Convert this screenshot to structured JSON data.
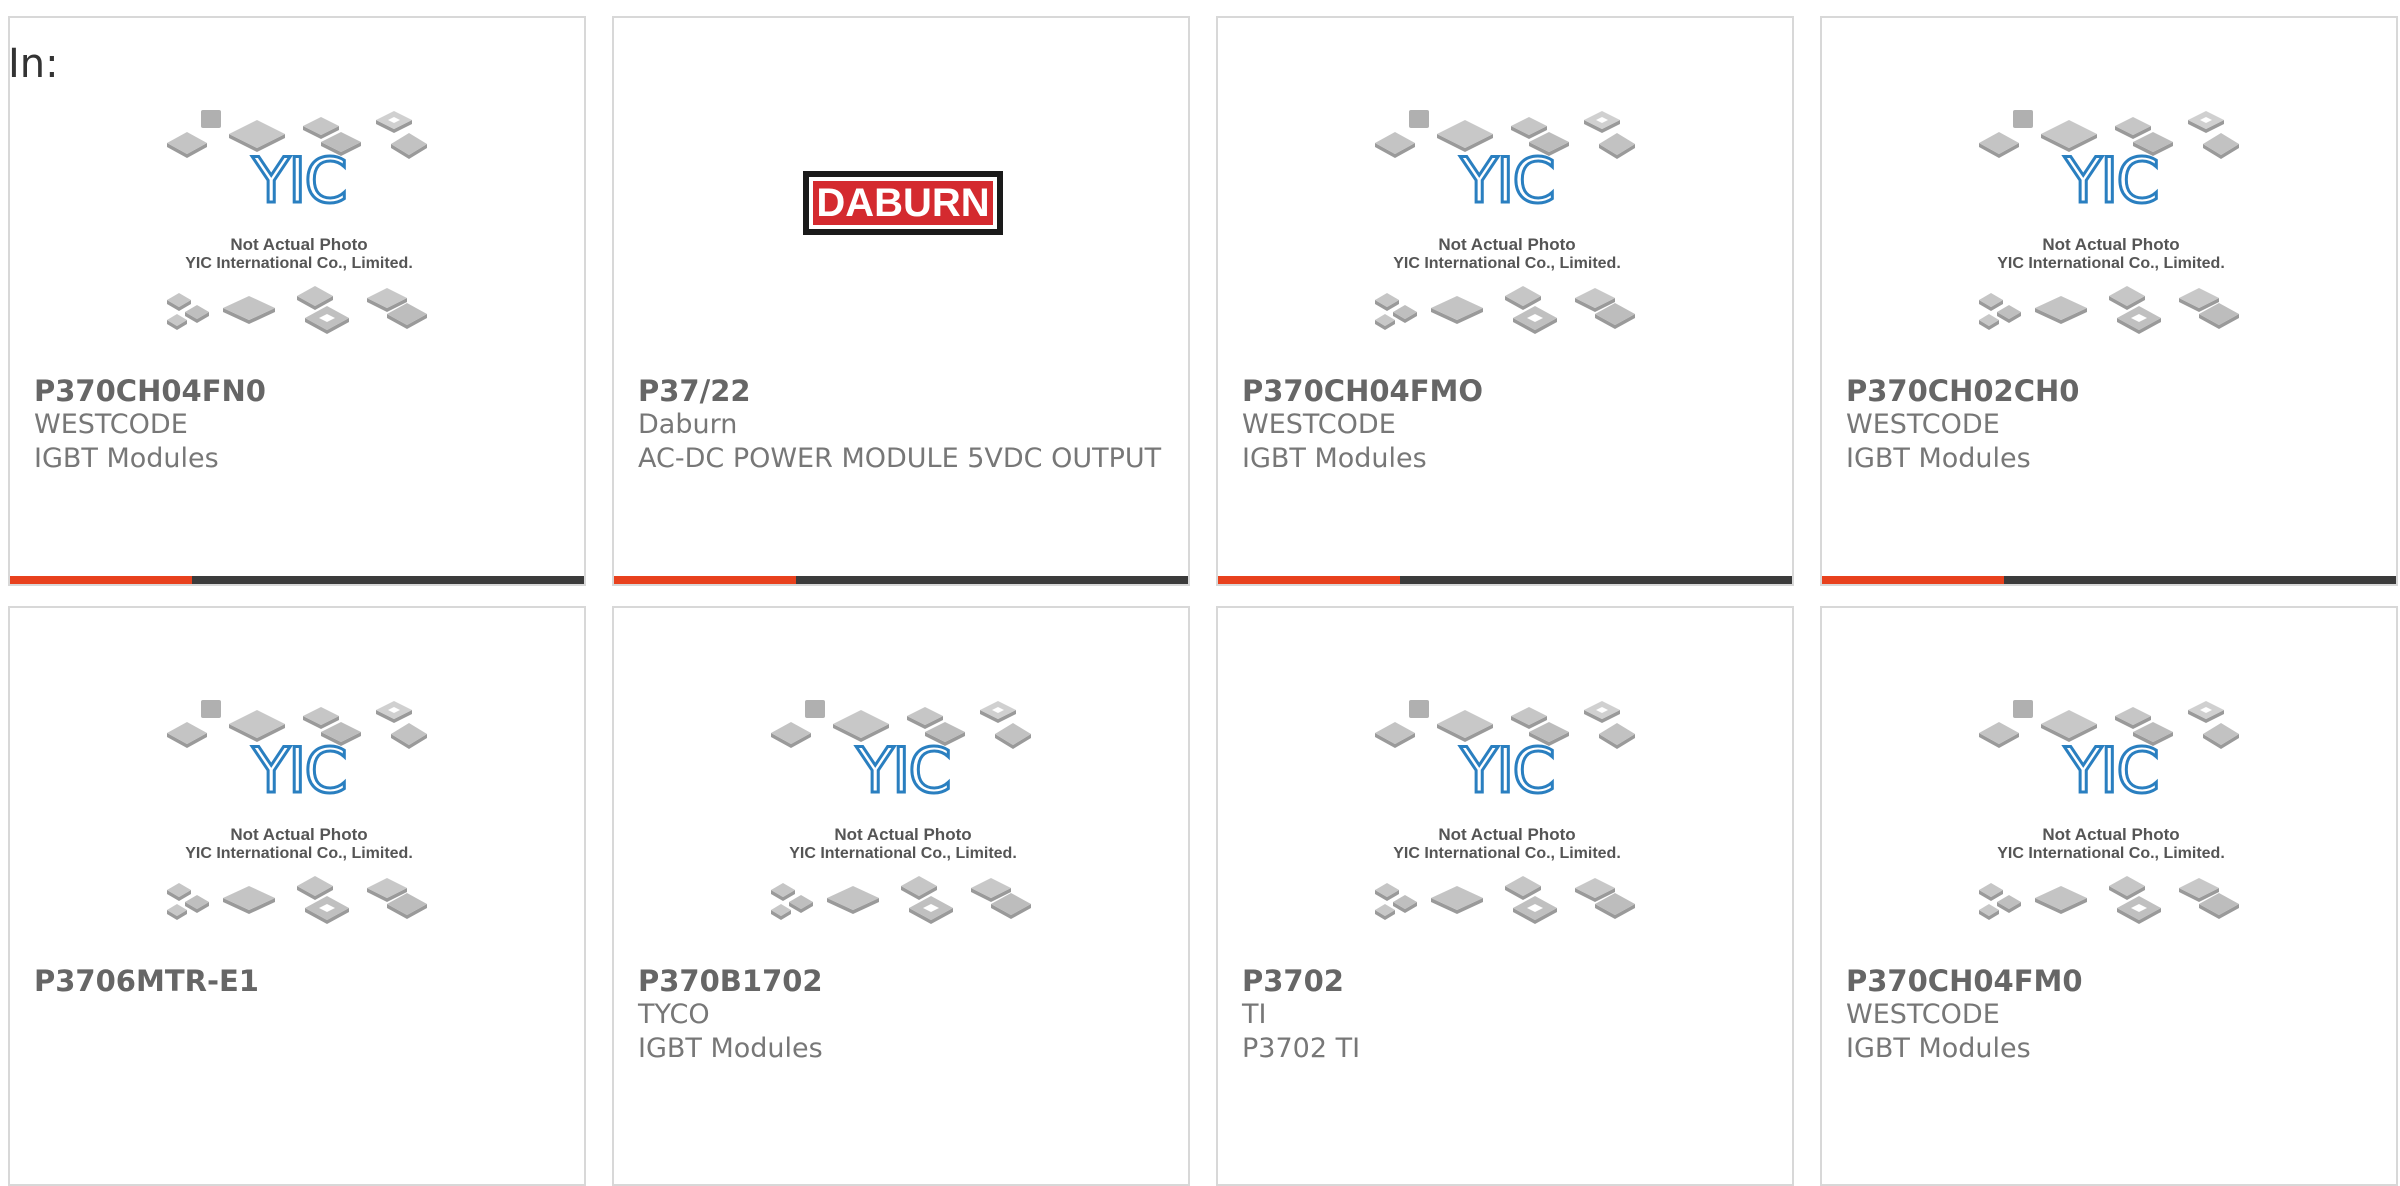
{
  "search_label": "In:",
  "accent_color": "#e8411d",
  "bar_color": "#3b3b3b",
  "placeholder": {
    "logo_text": "YIC",
    "caption_line1": "Not Actual Photo",
    "caption_line2": "YIC International Co., Limited."
  },
  "daburn_logo_text": "DABURN",
  "products": [
    {
      "part": "P370CH04FN0",
      "brand": "WESTCODE",
      "desc": "IGBT Modules",
      "image": "yic-placeholder"
    },
    {
      "part": "P37/22",
      "brand": "Daburn",
      "desc": "AC-DC POWER MODULE 5VDC OUTPUT",
      "image": "daburn-logo"
    },
    {
      "part": "P370CH04FMO",
      "brand": "WESTCODE",
      "desc": "IGBT Modules",
      "image": "yic-placeholder"
    },
    {
      "part": "P370CH02CH0",
      "brand": "WESTCODE",
      "desc": "IGBT Modules",
      "image": "yic-placeholder"
    },
    {
      "part": "P3706MTR-E1",
      "brand": "",
      "desc": "",
      "image": "yic-placeholder"
    },
    {
      "part": "P370B1702",
      "brand": "TYCO",
      "desc": "IGBT Modules",
      "image": "yic-placeholder"
    },
    {
      "part": "P3702",
      "brand": "TI",
      "desc": "P3702 TI",
      "image": "yic-placeholder"
    },
    {
      "part": "P370CH04FM0",
      "brand": "WESTCODE",
      "desc": "IGBT Modules",
      "image": "yic-placeholder"
    }
  ]
}
